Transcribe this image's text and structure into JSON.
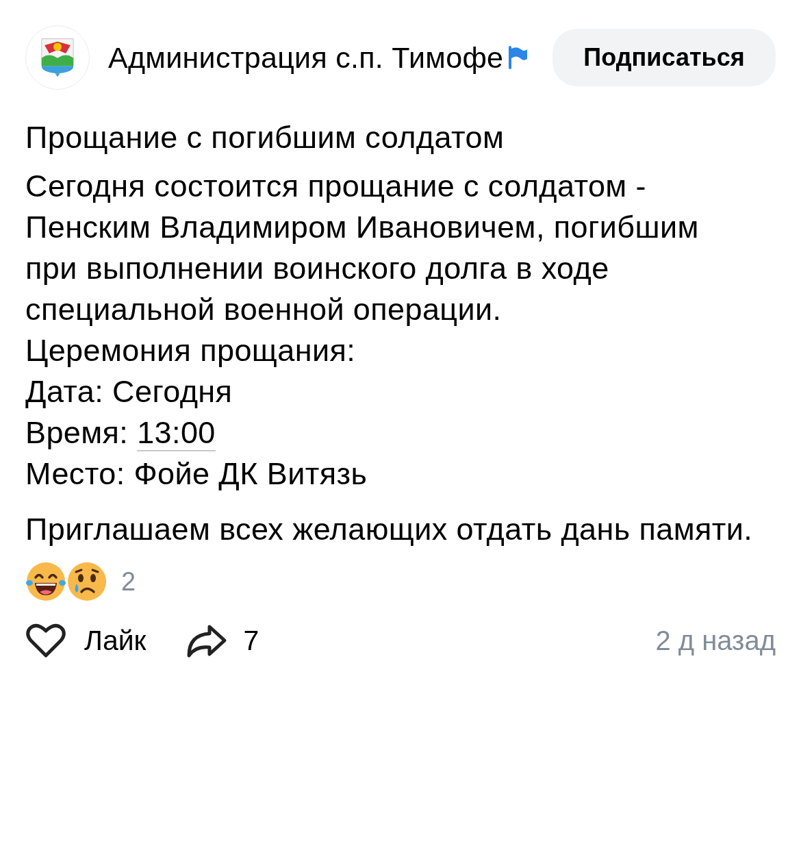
{
  "channel": {
    "name": "Администрация с.п. Тимофе"
  },
  "subscribe_button": "Подписаться",
  "post": {
    "title": "Прощание с погибшим солдатом",
    "body": [
      {
        "kind": "text",
        "text": "Сегодня состоится прощание с солдатом - Пенским Владимиром Ивановичем, погибшим при выполнении воинского долга в ходе специальной военной операции."
      },
      {
        "kind": "text",
        "text": "Церемония прощания:"
      },
      {
        "kind": "text",
        "text": "Дата: Сегодня"
      },
      {
        "kind": "link",
        "text": "Время: ",
        "link": "13:00"
      },
      {
        "kind": "text",
        "text": "Место: Фойе ДК Витязь"
      }
    ],
    "closing": "Приглашаем всех желающих отдать дань памяти."
  },
  "reactions": {
    "count": "2"
  },
  "actions": {
    "like": "Лайк",
    "shares": "7",
    "time": "2 д назад"
  }
}
